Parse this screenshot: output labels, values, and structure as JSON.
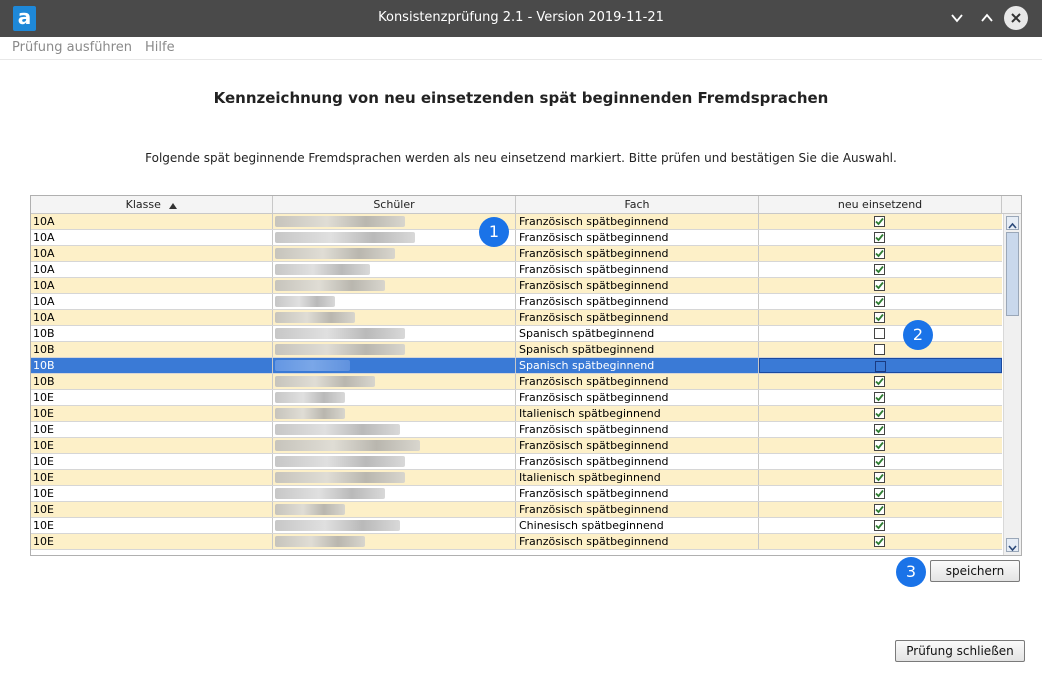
{
  "window": {
    "app_icon_letter": "a",
    "title": "Konsistenzprüfung 2.1 - Version 2019-11-21",
    "controls": [
      "minimize-icon",
      "maximize-icon",
      "close-icon"
    ]
  },
  "menu": [
    {
      "label": "Prüfung ausführen"
    },
    {
      "label": "Hilfe"
    }
  ],
  "heading": "Kennzeichnung von neu einsetzenden spät beginnenden Fremdsprachen",
  "instruction": "Folgende spät beginnende Fremdsprachen werden als neu einsetzend markiert. Bitte prüfen und bestätigen Sie die Auswahl.",
  "table": {
    "columns": [
      {
        "label": "Klasse",
        "sort": "ascending"
      },
      {
        "label": "Schüler"
      },
      {
        "label": "Fach"
      },
      {
        "label": "neu einsetzend"
      }
    ],
    "rows": [
      {
        "klasse": "10A",
        "fach": "Französisch spätbeginnend",
        "checked": true,
        "selected": false
      },
      {
        "klasse": "10A",
        "fach": "Französisch spätbeginnend",
        "checked": true,
        "selected": false
      },
      {
        "klasse": "10A",
        "fach": "Französisch spätbeginnend",
        "checked": true,
        "selected": false
      },
      {
        "klasse": "10A",
        "fach": "Französisch spätbeginnend",
        "checked": true,
        "selected": false
      },
      {
        "klasse": "10A",
        "fach": "Französisch spätbeginnend",
        "checked": true,
        "selected": false
      },
      {
        "klasse": "10A",
        "fach": "Französisch spätbeginnend",
        "checked": true,
        "selected": false
      },
      {
        "klasse": "10A",
        "fach": "Französisch spätbeginnend",
        "checked": true,
        "selected": false
      },
      {
        "klasse": "10B",
        "fach": "Spanisch spätbeginnend",
        "checked": false,
        "selected": false
      },
      {
        "klasse": "10B",
        "fach": "Spanisch spätbeginnend",
        "checked": false,
        "selected": false
      },
      {
        "klasse": "10B",
        "fach": "Spanisch spätbeginnend",
        "checked": false,
        "selected": true
      },
      {
        "klasse": "10B",
        "fach": "Französisch spätbeginnend",
        "checked": true,
        "selected": false
      },
      {
        "klasse": "10E",
        "fach": "Französisch spätbeginnend",
        "checked": true,
        "selected": false
      },
      {
        "klasse": "10E",
        "fach": "Italienisch spätbeginnend",
        "checked": true,
        "selected": false
      },
      {
        "klasse": "10E",
        "fach": "Französisch spätbeginnend",
        "checked": true,
        "selected": false
      },
      {
        "klasse": "10E",
        "fach": "Französisch spätbeginnend",
        "checked": true,
        "selected": false
      },
      {
        "klasse": "10E",
        "fach": "Französisch spätbeginnend",
        "checked": true,
        "selected": false
      },
      {
        "klasse": "10E",
        "fach": "Italienisch spätbeginnend",
        "checked": true,
        "selected": false
      },
      {
        "klasse": "10E",
        "fach": "Französisch spätbeginnend",
        "checked": true,
        "selected": false
      },
      {
        "klasse": "10E",
        "fach": "Französisch spätbeginnend",
        "checked": true,
        "selected": false
      },
      {
        "klasse": "10E",
        "fach": "Chinesisch spätbeginnend",
        "checked": true,
        "selected": false
      },
      {
        "klasse": "10E",
        "fach": "Französisch spätbeginnend",
        "checked": true,
        "selected": false
      }
    ]
  },
  "markers": [
    "1",
    "2",
    "3"
  ],
  "buttons": {
    "save": "speichern",
    "close": "Prüfung schließen"
  },
  "colors": {
    "titlebar": "#4a4a4a",
    "row_alt": "#fdf0c8",
    "selection": "#3a7ad6",
    "marker": "#1a73e8",
    "check": "#2e7d32"
  }
}
